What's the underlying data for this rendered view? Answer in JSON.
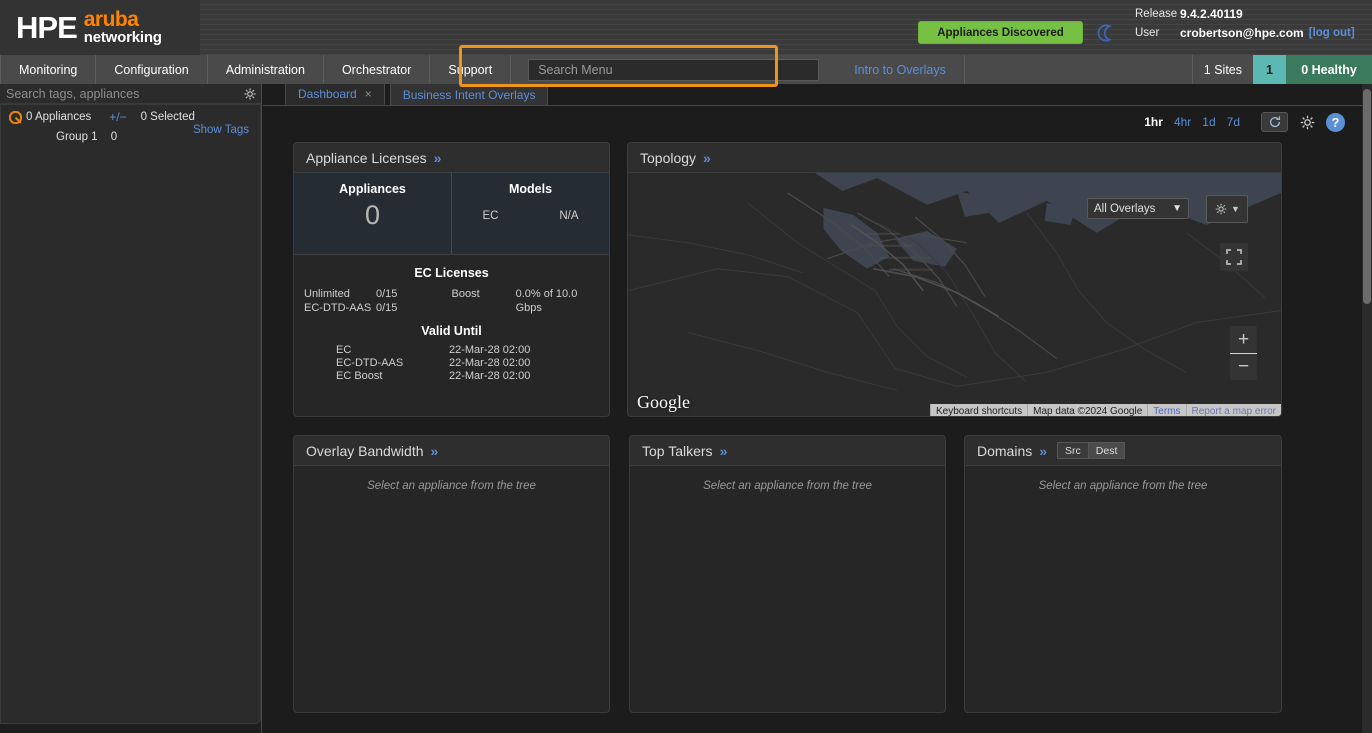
{
  "header": {
    "logo": {
      "hpe": "HPE",
      "aruba": "aruba",
      "networking": "networking"
    },
    "discovered_button": "Appliances Discovered",
    "theme_toggle_icon": "moon-icon",
    "release_label": "Release",
    "release_value": "9.4.2.40119",
    "user_label": "User",
    "user_value": "crobertson@hpe.com",
    "logout_label": "[log out]",
    "accent_orange": "#ff8300",
    "discovered_green": "#76c043"
  },
  "nav": {
    "items": [
      {
        "label": "Monitoring"
      },
      {
        "label": "Configuration"
      },
      {
        "label": "Administration"
      },
      {
        "label": "Orchestrator"
      },
      {
        "label": "Support"
      }
    ],
    "search_placeholder": "Search Menu",
    "search_value": "",
    "intro_link": "Intro to Overlays",
    "sites_label": "1 Sites",
    "count_value": "1",
    "healthy_label": "0 Healthy",
    "count_color": "#5cb8b2",
    "healthy_color": "#3b7a5c",
    "highlight_color": "#f0951b"
  },
  "sidebar": {
    "search_placeholder": "Search tags, appliances",
    "search_value": "",
    "gear_icon": "gear-icon",
    "appliances_label": "0 Appliances",
    "expand_collapse": "+/−",
    "selected_label": "0 Selected",
    "show_tags_label": "Show Tags",
    "group_label": "Group 1",
    "group_count": "0"
  },
  "tabs": [
    {
      "label": "Dashboard",
      "closable": true,
      "active": true
    },
    {
      "label": "Business Intent Overlays",
      "closable": false,
      "active": false
    }
  ],
  "toolbar": {
    "time_options": [
      {
        "label": "1hr",
        "active": true
      },
      {
        "label": "4hr",
        "active": false
      },
      {
        "label": "1d",
        "active": false
      },
      {
        "label": "7d",
        "active": false
      }
    ],
    "refresh_icon": "refresh-icon",
    "settings_icon": "gear-icon",
    "help_label": "?"
  },
  "panels": {
    "licenses": {
      "title": "Appliance Licenses",
      "expand_icon": "chevron-double-right-icon",
      "appliances_header": "Appliances",
      "appliances_count": "0",
      "models_header": "Models",
      "model_name": "EC",
      "model_value": "N/A",
      "ec_section_title": "EC Licenses",
      "ec_rows": [
        {
          "name": "Unlimited",
          "value": "0/15"
        },
        {
          "name": "EC-DTD-AAS",
          "value": "0/15"
        }
      ],
      "boost_label": "Boost",
      "boost_value": "0.0% of 10.0 Gbps",
      "valid_until_title": "Valid Until",
      "valid_rows": [
        {
          "name": "EC",
          "date": "22-Mar-28 02:00"
        },
        {
          "name": "EC-DTD-AAS",
          "date": "22-Mar-28 02:00"
        },
        {
          "name": "EC Boost",
          "date": "22-Mar-28 02:00"
        }
      ]
    },
    "topology": {
      "title": "Topology",
      "expand_icon": "chevron-double-right-icon",
      "overlay_select_value": "All Overlays",
      "settings_icon": "gear-icon",
      "fullscreen_icon": "fullscreen-icon",
      "zoom_in": "+",
      "zoom_out": "−",
      "google_logo": "Google",
      "attrib_keyboard": "Keyboard shortcuts",
      "attrib_mapdata": "Map data ©2024 Google",
      "attrib_terms": "Terms",
      "attrib_report": "Report a map error",
      "ocean_color": "#3e4450",
      "land_color": "#2a2a2a"
    },
    "bandwidth": {
      "title": "Overlay Bandwidth",
      "expand_icon": "chevron-double-right-icon",
      "empty_message": "Select an appliance from the tree"
    },
    "talkers": {
      "title": "Top Talkers",
      "expand_icon": "chevron-double-right-icon",
      "empty_message": "Select an appliance from the tree"
    },
    "domains": {
      "title": "Domains",
      "expand_icon": "chevron-double-right-icon",
      "seg_src": "Src",
      "seg_dest": "Dest",
      "empty_message": "Select an appliance from the tree"
    }
  }
}
